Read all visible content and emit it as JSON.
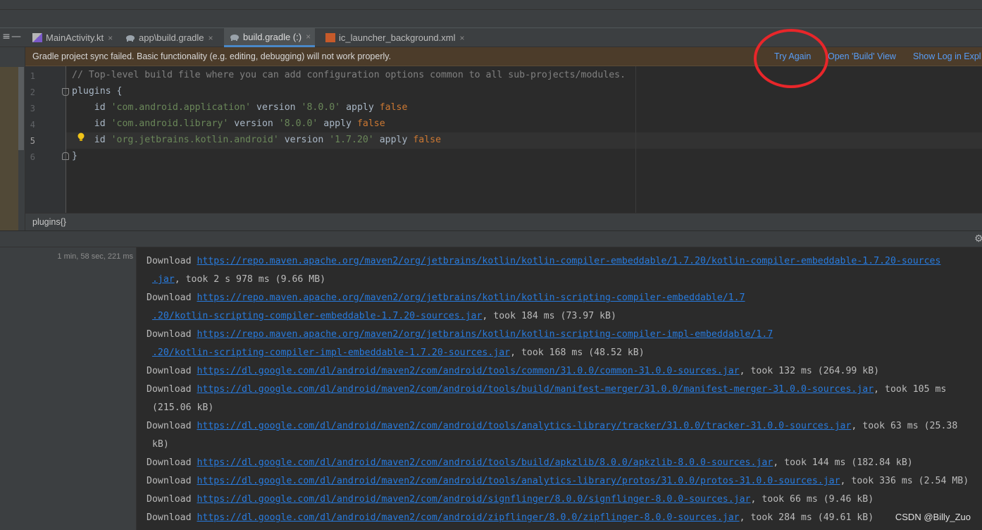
{
  "tabs": [
    {
      "label": "MainActivity.kt",
      "icon": "kotlin-file-icon",
      "active": false
    },
    {
      "label": "app\\build.gradle",
      "icon": "gradle-elephant-icon",
      "active": false
    },
    {
      "label": "build.gradle (:)",
      "icon": "gradle-elephant-icon",
      "active": true
    },
    {
      "label": "ic_launcher_background.xml",
      "icon": "xml-file-icon",
      "active": false
    }
  ],
  "tab_close_glyph": "×",
  "banner": {
    "message": "Gradle project sync failed. Basic functionality (e.g. editing, debugging) will not work properly.",
    "try_again": "Try Again",
    "open_build": "Open 'Build' View",
    "show_log": "Show Log in Expl"
  },
  "editor": {
    "line_numbers": [
      "1",
      "2",
      "3",
      "4",
      "5",
      "6"
    ],
    "current_line": 5,
    "lines": [
      [
        {
          "t": "// Top-level build file where you can add configuration options common to all sub-projects/modules.",
          "k": "comment"
        }
      ],
      [
        {
          "t": "plugins {",
          "k": "plain"
        }
      ],
      [
        {
          "t": "    id ",
          "k": "plain"
        },
        {
          "t": "'com.android.application'",
          "k": "str"
        },
        {
          "t": " version ",
          "k": "plain"
        },
        {
          "t": "'8.0.0'",
          "k": "str"
        },
        {
          "t": " apply ",
          "k": "plain"
        },
        {
          "t": "false",
          "k": "kw"
        }
      ],
      [
        {
          "t": "    id ",
          "k": "plain"
        },
        {
          "t": "'com.android.library'",
          "k": "str"
        },
        {
          "t": " version ",
          "k": "plain"
        },
        {
          "t": "'8.0.0'",
          "k": "str"
        },
        {
          "t": " apply ",
          "k": "plain"
        },
        {
          "t": "false",
          "k": "kw"
        }
      ],
      [
        {
          "t": "    id ",
          "k": "plain"
        },
        {
          "t": "'org.jetbrains.kotlin.android'",
          "k": "str"
        },
        {
          "t": " version ",
          "k": "plain"
        },
        {
          "t": "'1.7.20'",
          "k": "str"
        },
        {
          "t": " apply ",
          "k": "plain"
        },
        {
          "t": "false",
          "k": "kw"
        }
      ],
      [
        {
          "t": "}",
          "k": "plain"
        }
      ]
    ]
  },
  "breadcrumb": "plugins{}",
  "build": {
    "elapsed": "1 min, 58 sec, 221 ms",
    "lines": [
      [
        {
          "t": "Download ",
          "k": "plain"
        },
        {
          "t": "https://repo.maven.apache.org/maven2/org/jetbrains/kotlin/kotlin-compiler-embeddable/1.7.20/kotlin-compiler-embeddable-1.7.20-sources",
          "k": "link"
        }
      ],
      [
        {
          "t": " ",
          "k": "plain"
        },
        {
          "t": ".jar",
          "k": "link"
        },
        {
          "t": ", took 2 s 978 ms (9.66 MB)",
          "k": "plain"
        }
      ],
      [
        {
          "t": "Download ",
          "k": "plain"
        },
        {
          "t": "https://repo.maven.apache.org/maven2/org/jetbrains/kotlin/kotlin-scripting-compiler-embeddable/1.7",
          "k": "link"
        }
      ],
      [
        {
          "t": " ",
          "k": "plain"
        },
        {
          "t": ".20/kotlin-scripting-compiler-embeddable-1.7.20-sources.jar",
          "k": "link"
        },
        {
          "t": ", took 184 ms (73.97 kB)",
          "k": "plain"
        }
      ],
      [
        {
          "t": "Download ",
          "k": "plain"
        },
        {
          "t": "https://repo.maven.apache.org/maven2/org/jetbrains/kotlin/kotlin-scripting-compiler-impl-embeddable/1.7",
          "k": "link"
        }
      ],
      [
        {
          "t": " ",
          "k": "plain"
        },
        {
          "t": ".20/kotlin-scripting-compiler-impl-embeddable-1.7.20-sources.jar",
          "k": "link"
        },
        {
          "t": ", took 168 ms (48.52 kB)",
          "k": "plain"
        }
      ],
      [
        {
          "t": "Download ",
          "k": "plain"
        },
        {
          "t": "https://dl.google.com/dl/android/maven2/com/android/tools/common/31.0.0/common-31.0.0-sources.jar",
          "k": "link"
        },
        {
          "t": ", took 132 ms (264.99 kB)",
          "k": "plain"
        }
      ],
      [
        {
          "t": "Download ",
          "k": "plain"
        },
        {
          "t": "https://dl.google.com/dl/android/maven2/com/android/tools/build/manifest-merger/31.0.0/manifest-merger-31.0.0-sources.jar",
          "k": "link"
        },
        {
          "t": ", took 105 ms",
          "k": "plain"
        }
      ],
      [
        {
          "t": " (215.06 kB)",
          "k": "plain"
        }
      ],
      [
        {
          "t": "Download ",
          "k": "plain"
        },
        {
          "t": "https://dl.google.com/dl/android/maven2/com/android/tools/analytics-library/tracker/31.0.0/tracker-31.0.0-sources.jar",
          "k": "link"
        },
        {
          "t": ", took 63 ms (25.38",
          "k": "plain"
        }
      ],
      [
        {
          "t": " kB)",
          "k": "plain"
        }
      ],
      [
        {
          "t": "Download ",
          "k": "plain"
        },
        {
          "t": "https://dl.google.com/dl/android/maven2/com/android/tools/build/apkzlib/8.0.0/apkzlib-8.0.0-sources.jar",
          "k": "link"
        },
        {
          "t": ", took 144 ms (182.84 kB)",
          "k": "plain"
        }
      ],
      [
        {
          "t": "Download ",
          "k": "plain"
        },
        {
          "t": "https://dl.google.com/dl/android/maven2/com/android/tools/analytics-library/protos/31.0.0/protos-31.0.0-sources.jar",
          "k": "link"
        },
        {
          "t": ", took 336 ms (2.54 MB)",
          "k": "plain"
        }
      ],
      [
        {
          "t": "Download ",
          "k": "plain"
        },
        {
          "t": "https://dl.google.com/dl/android/maven2/com/android/signflinger/8.0.0/signflinger-8.0.0-sources.jar",
          "k": "link"
        },
        {
          "t": ", took 66 ms (9.46 kB)",
          "k": "plain"
        }
      ],
      [
        {
          "t": "Download ",
          "k": "plain"
        },
        {
          "t": "https://dl.google.com/dl/android/maven2/com/android/zipflinger/8.0.0/zipflinger-8.0.0-sources.jar",
          "k": "link"
        },
        {
          "t": ", took 284 ms (49.61 kB)",
          "k": "plain"
        }
      ]
    ]
  },
  "watermark": "CSDN @Billy_Zuo",
  "colors": {
    "accent": "#4a88c7",
    "link": "#287bde",
    "banner_bg": "#4c3c2a",
    "annotation_circle": "#e8262a"
  }
}
